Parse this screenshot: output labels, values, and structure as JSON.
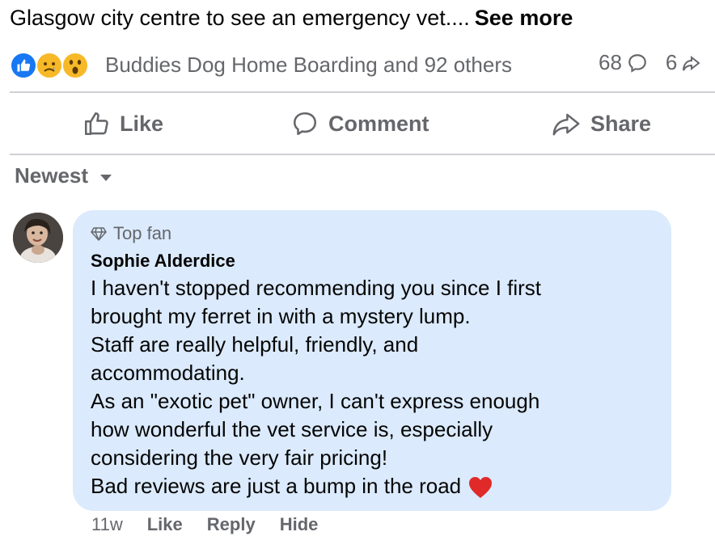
{
  "post": {
    "text": "Glasgow city centre to see an emergency vet....",
    "see_more": "See more"
  },
  "reactions": {
    "types": [
      "like",
      "sad",
      "wow"
    ],
    "reactors": "Buddies Dog Home Boarding and 92 others",
    "comment_count": "68",
    "share_count": "6"
  },
  "actions": {
    "like": "Like",
    "comment": "Comment",
    "share": "Share"
  },
  "sort": {
    "label": "Newest"
  },
  "comment": {
    "badge": "Top fan",
    "author": "Sophie Alderdice",
    "lines": [
      "I haven't stopped recommending you since I first",
      "brought my ferret in with a mystery lump.",
      "Staff are really helpful, friendly, and",
      "accommodating.",
      "As an \"exotic pet\" owner, I can't express enough",
      "how wonderful the vet service is, especially",
      "considering the very fair pricing!",
      "Bad reviews are just a bump in the road"
    ],
    "time": "11w",
    "like": "Like",
    "reply": "Reply",
    "hide": "Hide"
  },
  "colors": {
    "facebook_blue": "#1877f2",
    "bubble_bg": "#dbeafc",
    "secondary_text": "#65676b",
    "heart_red": "#e02a2a"
  }
}
